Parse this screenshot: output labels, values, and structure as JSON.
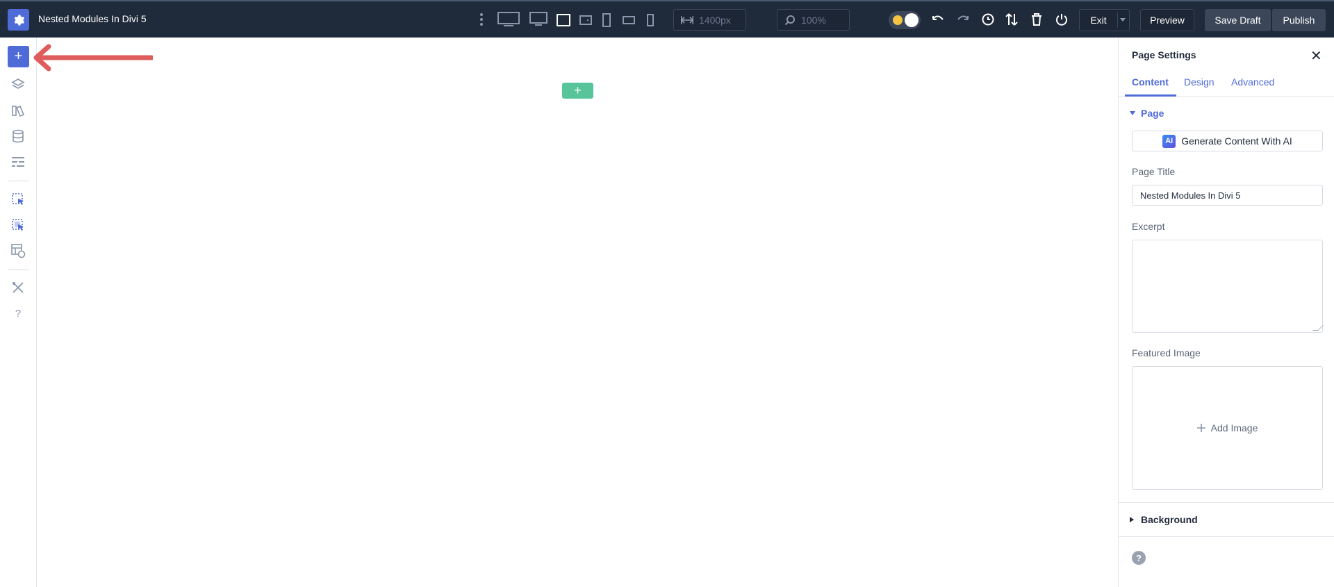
{
  "topbar": {
    "page_name": "Nested Modules In Divi 5",
    "width_value": "1400px",
    "zoom_value": "100%",
    "exit_label": "Exit",
    "preview_label": "Preview",
    "save_draft_label": "Save Draft",
    "publish_label": "Publish"
  },
  "canvas": {
    "add_label": "+"
  },
  "sidebar": {
    "add_label": "+",
    "help_label": "?"
  },
  "panel": {
    "title": "Page Settings",
    "close_label": "✕",
    "tabs": [
      {
        "label": "Content"
      },
      {
        "label": "Design"
      },
      {
        "label": "Advanced"
      }
    ],
    "section_page": "Page",
    "ai_badge": "AI",
    "ai_button": "Generate Content With AI",
    "page_title_label": "Page Title",
    "page_title_value": "Nested Modules In Divi 5",
    "excerpt_label": "Excerpt",
    "featured_image_label": "Featured Image",
    "add_image_label": "Add Image",
    "background_label": "Background",
    "help_label": "?"
  },
  "colors": {
    "topbar_bg": "#1f2a3a",
    "accent": "#4f6bd8",
    "canvas_add": "#57c49a",
    "arrow": "#e05c5c"
  }
}
